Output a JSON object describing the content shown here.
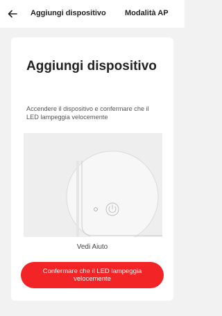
{
  "header": {
    "back_icon": "arrow-left-icon",
    "title": "Aggiungi dispositivo",
    "mode_link": "Modalità AP"
  },
  "card": {
    "heading": "Aggiungi dispositivo",
    "instructions": "Accendere il dispositivo e confermare che il LED lampeggia velocemente",
    "illustration": {
      "led_icon": "led-dot-icon",
      "power_icon": "power-icon"
    },
    "help_link": "Vedi Aiuto",
    "confirm_button": "Confermare che il LED lampeggia velocemente"
  },
  "colors": {
    "accent": "#f22425",
    "background": "#f2f2f2",
    "card": "#ffffff"
  }
}
